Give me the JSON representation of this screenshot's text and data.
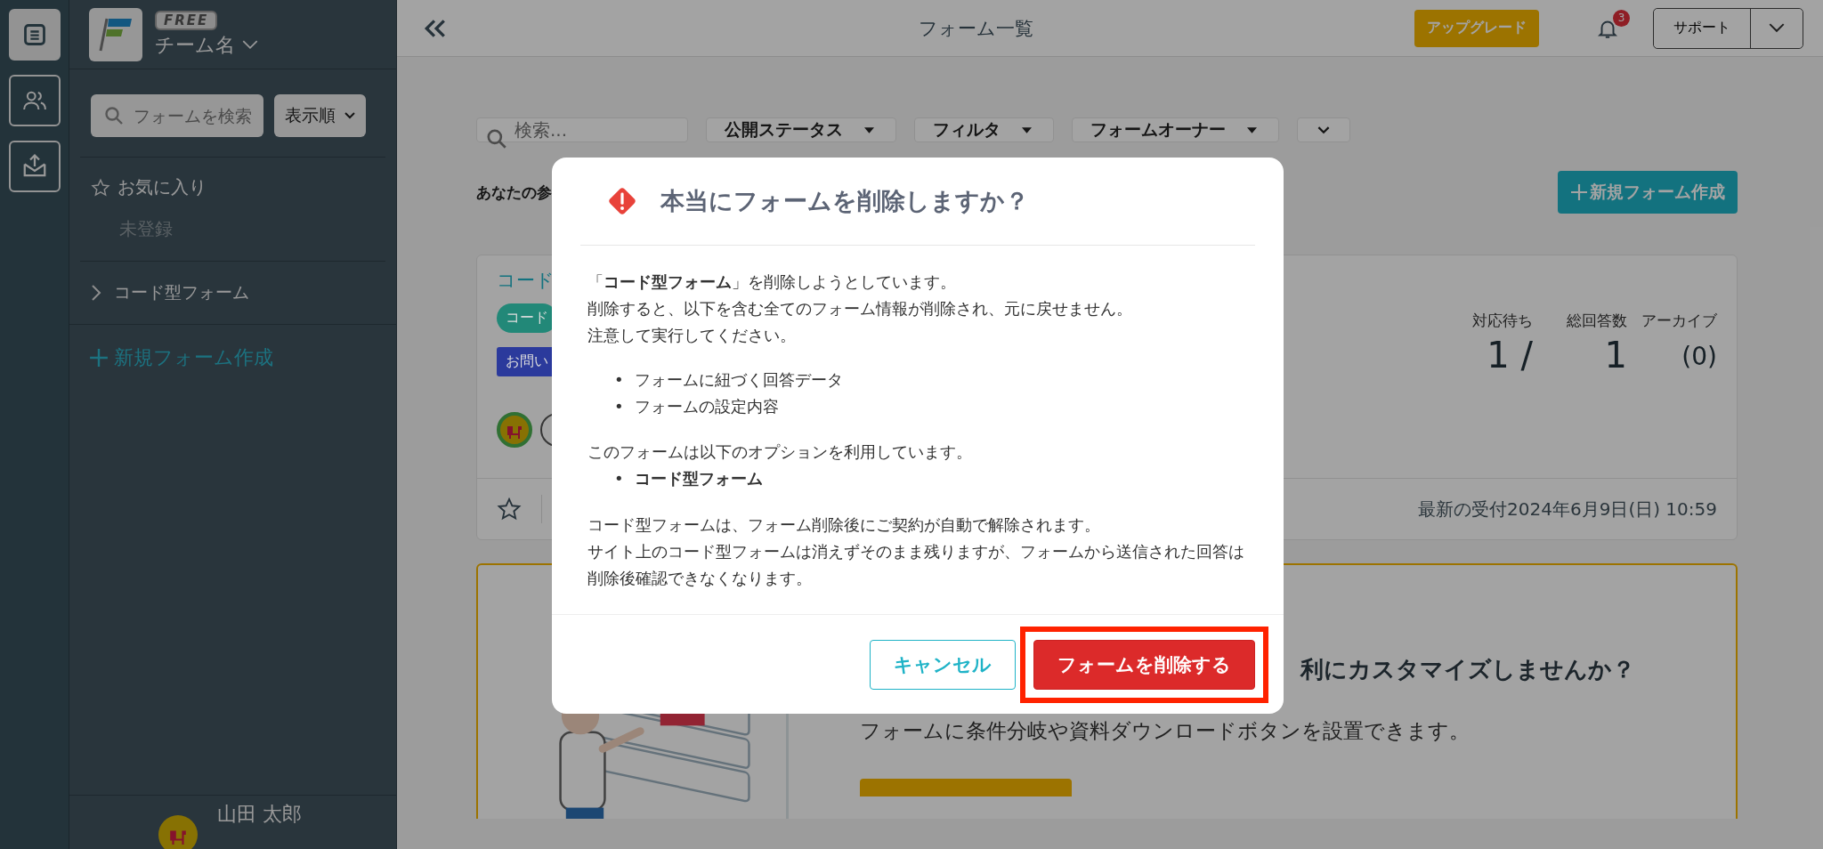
{
  "icon_rail": [
    {
      "selected": true
    },
    {
      "selected": false
    },
    {
      "selected": false
    }
  ],
  "sidebar": {
    "plan_badge": "FREE",
    "team_name": "チーム名",
    "search": {
      "placeholder": "フォームを検索"
    },
    "sort_button": "表示順",
    "favorites": {
      "label": "お気に入り",
      "empty": "未登録"
    },
    "folders": [
      {
        "label": "コード型フォーム",
        "expanded": false
      }
    ],
    "new_form": "新規フォーム作成",
    "user_name": "山田 太郎"
  },
  "header": {
    "title": "フォーム一覧",
    "upgrade_button": "アップグレード",
    "notification_count": "3",
    "support_button": "サポート"
  },
  "toolbar": {
    "search": {
      "placeholder": "検索..."
    },
    "filters": [
      "公開ステータス",
      "フィルタ",
      "フォームオーナー"
    ]
  },
  "section_title": "あなたの参",
  "new_form_button": "新規フォーム作成",
  "form_card": {
    "title": "コード",
    "tags": [
      {
        "label": "コード",
        "color": "#228878"
      },
      {
        "label": "お問い",
        "color": "#2b3a9c"
      }
    ],
    "stats": [
      {
        "label": "対応待ち",
        "value": "1 /"
      },
      {
        "label": "総回答数",
        "value": "1"
      },
      {
        "label": "アーカイブ",
        "value": "(0)"
      }
    ],
    "favorite": false,
    "latest": "最新の受付2024年6月9日(日) 10:59"
  },
  "promo": {
    "title": "利にカスタマイズしませんか？",
    "text": "フォームに条件分岐や資料ダウンロードボタンを設置できます。"
  },
  "dialog": {
    "title": "本当にフォームを削除しますか？",
    "intro": [
      "「**コード型フォーム**」を削除しようとしています。",
      "削除すると、以下を含む全てのフォーム情報が削除され、元に戻せません。",
      "注意して実行してください。"
    ],
    "list_marker": "•",
    "items": [
      "フォームに紐づく回答データ",
      "フォームの設定内容"
    ],
    "options_intro": "このフォームは以下のオプションを利用しています。",
    "options": [
      "コード型フォーム"
    ],
    "notes": [
      "コード型フォームは、フォーム削除後にご契約が自動で解除されます。",
      "サイト上のコード型フォームは消えずそのまま残りますが、フォームから送信された回答は削除後確認できなくなります。"
    ],
    "cancel_button": "キャンセル",
    "delete_button": "フォームを削除する",
    "delete_highlighted": true
  }
}
